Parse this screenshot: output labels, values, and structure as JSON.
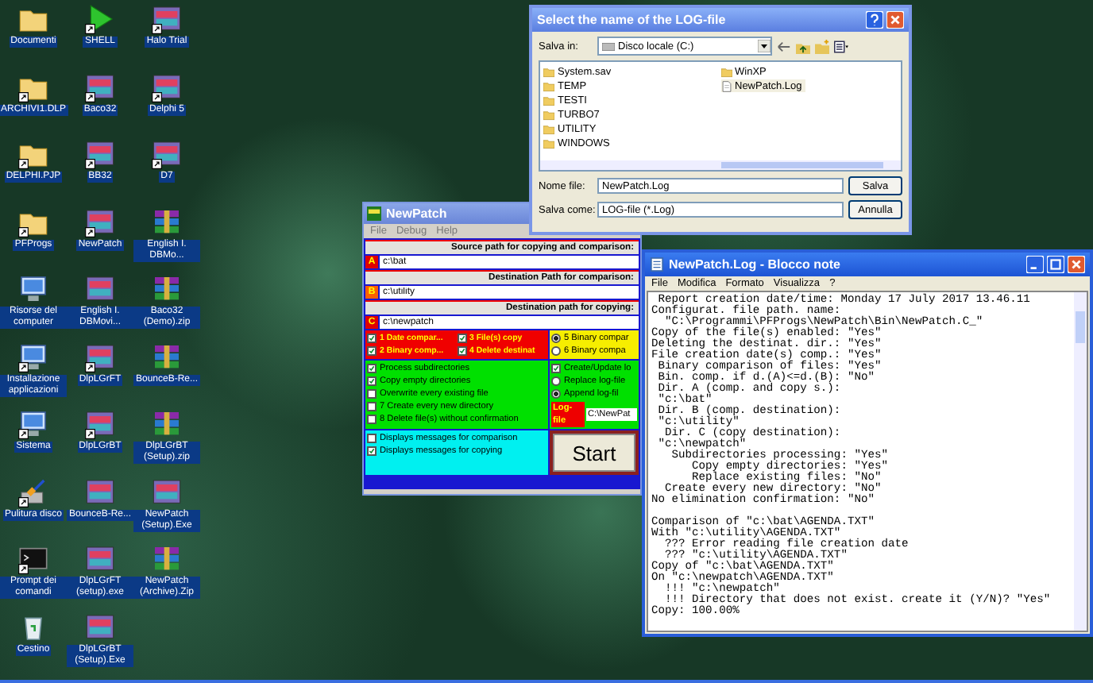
{
  "desktop_icons": [
    {
      "label": "Documenti",
      "kind": "folder",
      "shortcut": false
    },
    {
      "label": "ARCHIVI1.DLP",
      "kind": "folder",
      "shortcut": true
    },
    {
      "label": "DELPHI.PJP",
      "kind": "folder",
      "shortcut": true
    },
    {
      "label": "PFProgs",
      "kind": "folder",
      "shortcut": true
    },
    {
      "label": "Risorse del computer",
      "kind": "computer",
      "shortcut": false
    },
    {
      "label": "Installazione applicazioni",
      "kind": "computer",
      "shortcut": true
    },
    {
      "label": "Sistema",
      "kind": "computer",
      "shortcut": true
    },
    {
      "label": "Pulitura disco",
      "kind": "cleaner",
      "shortcut": true
    },
    {
      "label": "Prompt dei comandi",
      "kind": "console",
      "shortcut": true
    },
    {
      "label": "Cestino",
      "kind": "bin",
      "shortcut": false
    },
    {
      "label": "SHELL",
      "kind": "play",
      "shortcut": true
    },
    {
      "label": "Baco32",
      "kind": "app",
      "shortcut": true
    },
    {
      "label": "BB32",
      "kind": "app",
      "shortcut": true
    },
    {
      "label": "NewPatch",
      "kind": "app",
      "shortcut": true
    },
    {
      "label": "English I. DBMovi...",
      "kind": "app",
      "shortcut": false
    },
    {
      "label": "DlpLGrFT",
      "kind": "app",
      "shortcut": true
    },
    {
      "label": "DlpLGrBT",
      "kind": "app",
      "shortcut": true
    },
    {
      "label": "BounceB-Re...",
      "kind": "app",
      "shortcut": false
    },
    {
      "label": "DlpLGrFT (setup).exe",
      "kind": "app",
      "shortcut": false
    },
    {
      "label": "DlpLGrBT (Setup).Exe",
      "kind": "app",
      "shortcut": false
    },
    {
      "label": "Halo Trial",
      "kind": "app",
      "shortcut": true
    },
    {
      "label": "Delphi 5",
      "kind": "app",
      "shortcut": true
    },
    {
      "label": "D7",
      "kind": "app",
      "shortcut": true
    },
    {
      "label": "English I. DBMo...",
      "kind": "archive",
      "shortcut": false
    },
    {
      "label": "Baco32 (Demo).zip",
      "kind": "archive",
      "shortcut": false
    },
    {
      "label": "BounceB-Re...",
      "kind": "archive",
      "shortcut": false
    },
    {
      "label": "DlpLGrBT (Setup).zip",
      "kind": "archive",
      "shortcut": false
    },
    {
      "label": "NewPatch (Setup).Exe",
      "kind": "app",
      "shortcut": false
    },
    {
      "label": "NewPatch (Archive).Zip",
      "kind": "archive",
      "shortcut": false
    }
  ],
  "newpatch": {
    "title": "NewPatch",
    "menu": [
      "File",
      "Debug",
      "Help"
    ],
    "paths": [
      {
        "caption": "Source path for copying and comparison:",
        "letter": "A",
        "value": "c:\\bat"
      },
      {
        "caption": "Destination Path for comparison:",
        "letter": "B",
        "value": "c:\\utility"
      },
      {
        "caption": "Destination path for copying:",
        "letter": "C",
        "value": "c:\\newpatch"
      }
    ],
    "compare_options": [
      {
        "label": "1 Date compar...",
        "checked": true
      },
      {
        "label": "3 File(s) copy",
        "checked": true
      },
      {
        "label": "2 Binary comp...",
        "checked": true
      },
      {
        "label": "4 Delete destinat",
        "checked": true
      }
    ],
    "binary_modes": [
      {
        "label": "5 Binary compar",
        "selected": true
      },
      {
        "label": "6 Binary compa",
        "selected": false
      }
    ],
    "processing_options": [
      {
        "label": "Process subdirectories",
        "checked": true
      },
      {
        "label": "Copy empty directories",
        "checked": true
      },
      {
        "label": "Overwrite every existing file",
        "checked": false
      },
      {
        "label": "7 Create every new directory",
        "checked": false
      },
      {
        "label": "8 Delete file(s) without confirmation",
        "checked": false
      }
    ],
    "log": {
      "create": {
        "label": "Create/Update lo",
        "checked": true
      },
      "modes": [
        {
          "label": "Replace log-file",
          "selected": false
        },
        {
          "label": "Append log-fil",
          "selected": true
        }
      ],
      "file_label": "Log-file",
      "file_value": "C:\\NewPat"
    },
    "message_options": [
      {
        "label": "Displays messages for comparison",
        "checked": false
      },
      {
        "label": "Displays messages for copying",
        "checked": true
      }
    ],
    "start_button": "Start"
  },
  "save_dialog": {
    "title": "Select the name of the LOG-file",
    "save_in_label": "Salva in:",
    "save_in_value": "Disco locale (C:)",
    "files": [
      {
        "name": "System.sav",
        "kind": "folder",
        "selected": false
      },
      {
        "name": "TEMP",
        "kind": "folder",
        "selected": false
      },
      {
        "name": "TESTI",
        "kind": "folder",
        "selected": false
      },
      {
        "name": "TURBO7",
        "kind": "folder",
        "selected": false
      },
      {
        "name": "UTILITY",
        "kind": "folder",
        "selected": false
      },
      {
        "name": "WINDOWS",
        "kind": "folder",
        "selected": false
      },
      {
        "name": "WinXP",
        "kind": "folder",
        "selected": false
      },
      {
        "name": "NewPatch.Log",
        "kind": "file",
        "selected": true
      }
    ],
    "filename_label": "Nome file:",
    "filename_value": "NewPatch.Log",
    "type_label": "Salva come:",
    "type_value": "LOG-file (*.Log)",
    "save_button": "Salva",
    "cancel_button": "Annulla"
  },
  "notepad": {
    "title": "NewPatch.Log - Blocco note",
    "menu": [
      "File",
      "Modifica",
      "Formato",
      "Visualizza",
      "?"
    ],
    "text": " Report creation date/time: Monday 17 July 2017 13.46.11\nConfigurat. file path. name:\n  \"C:\\Programmi\\PFProgs\\NewPatch\\Bin\\NewPatch.C_\"\nCopy of the file(s) enabled: \"Yes\"\nDeleting the destinat. dir.: \"Yes\"\nFile creation date(s) comp.: \"Yes\"\n Binary comparison of files: \"Yes\"\n Bin. comp. if d.(A)<=d.(B): \"No\"\n Dir. A (comp. and copy s.):\n \"c:\\bat\"\n Dir. B (comp. destination):\n \"c:\\utility\"\n  Dir. C (copy destination):\n \"c:\\newpatch\"\n   Subdirectories processing: \"Yes\"\n      Copy empty directories: \"Yes\"\n      Replace existing files: \"No\"\n  Create every new directory: \"No\"\nNo elimination confirmation: \"No\"\n\nComparison of \"c:\\bat\\AGENDA.TXT\"\nWith \"c:\\utility\\AGENDA.TXT\"\n  ??? Error reading file creation date\n  ??? \"c:\\utility\\AGENDA.TXT\"\nCopy of \"c:\\bat\\AGENDA.TXT\"\nOn \"c:\\newpatch\\AGENDA.TXT\"\n  !!! \"c:\\newpatch\"\n  !!! Directory that does not exist. create it (Y/N)? \"Yes\"\nCopy: 100.00%"
  }
}
